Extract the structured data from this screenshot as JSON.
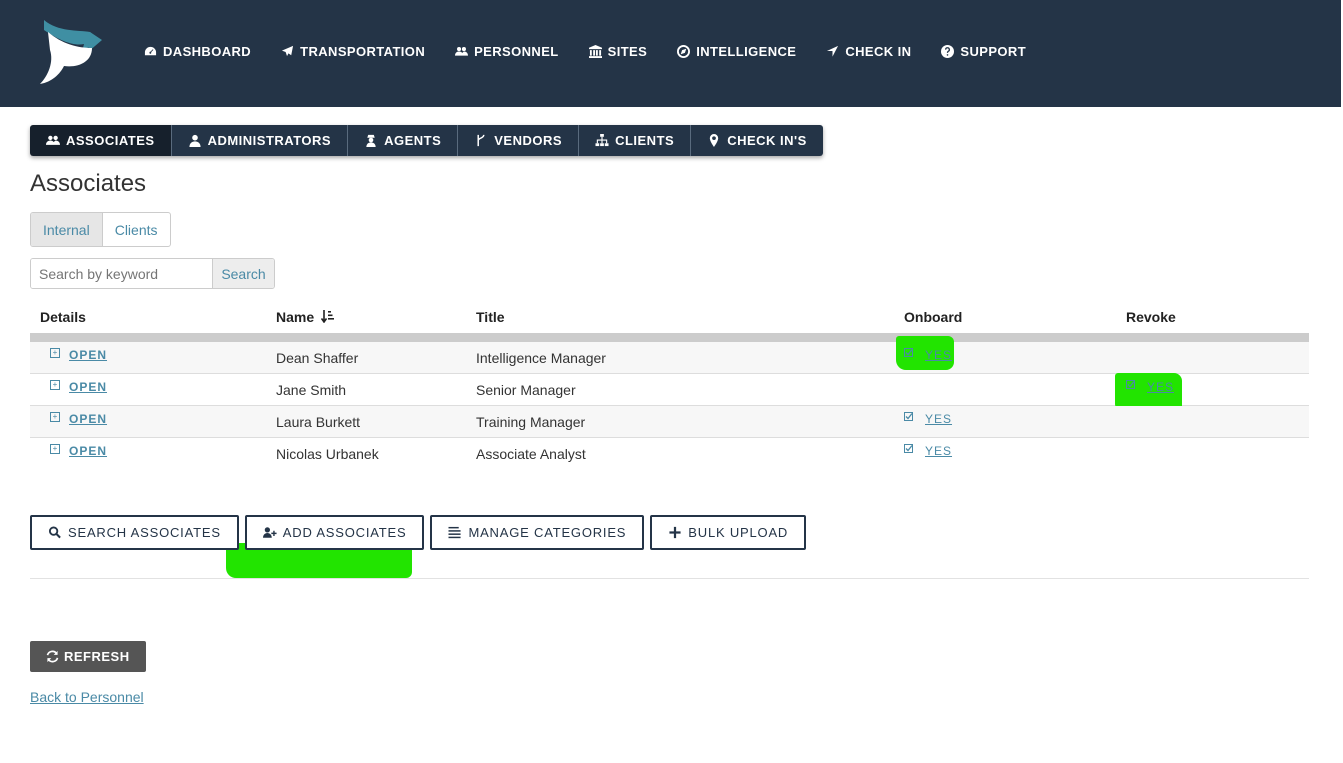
{
  "nav": {
    "items": [
      {
        "label": "DASHBOARD",
        "icon": "dashboard-icon"
      },
      {
        "label": "TRANSPORTATION",
        "icon": "plane-icon"
      },
      {
        "label": "PERSONNEL",
        "icon": "users-icon"
      },
      {
        "label": "SITES",
        "icon": "bank-icon"
      },
      {
        "label": "INTELLIGENCE",
        "icon": "compass-icon"
      },
      {
        "label": "CHECK IN",
        "icon": "location-arrow-icon"
      },
      {
        "label": "SUPPORT",
        "icon": "question-circle-icon"
      }
    ]
  },
  "tabs": [
    {
      "label": "ASSOCIATES",
      "icon": "users-icon",
      "active": true
    },
    {
      "label": "ADMINISTRATORS",
      "icon": "user-icon",
      "active": false
    },
    {
      "label": "AGENTS",
      "icon": "user-secret-icon",
      "active": false
    },
    {
      "label": "VENDORS",
      "icon": "code-fork-icon",
      "active": false
    },
    {
      "label": "CLIENTS",
      "icon": "sitemap-icon",
      "active": false
    },
    {
      "label": "CHECK IN'S",
      "icon": "map-marker-icon",
      "active": false
    }
  ],
  "page": {
    "title": "Associates"
  },
  "toggle": {
    "internal": "Internal",
    "clients": "Clients",
    "selected": "Internal"
  },
  "search": {
    "placeholder": "Search by keyword",
    "button": "Search"
  },
  "grid": {
    "columns": {
      "details": "Details",
      "name": "Name",
      "title": "Title",
      "onboard": "Onboard",
      "revoke": "Revoke"
    },
    "sort_icon": "sort-amount-asc-icon",
    "open_label": "OPEN",
    "yes_label": "YES",
    "rows": [
      {
        "name": "Dean Shaffer",
        "title": "Intelligence Manager",
        "onboard": true,
        "revoke": false
      },
      {
        "name": "Jane Smith",
        "title": "Senior Manager",
        "onboard": false,
        "revoke": true
      },
      {
        "name": "Laura Burkett",
        "title": "Training Manager",
        "onboard": true,
        "revoke": false
      },
      {
        "name": "Nicolas Urbanek",
        "title": "Associate Analyst",
        "onboard": true,
        "revoke": false
      }
    ]
  },
  "actions": {
    "search_associates": "SEARCH ASSOCIATES",
    "add_associates": "ADD ASSOCIATES",
    "manage_categories": "MANAGE CATEGORIES",
    "bulk_upload": "BULK UPLOAD"
  },
  "refresh": {
    "label": "REFRESH"
  },
  "back_link": "Back to Personnel",
  "colors": {
    "nav_bg": "#243447",
    "link": "#4a8aa6",
    "highlight": "#22e400",
    "logo": "#3f8fa3"
  }
}
